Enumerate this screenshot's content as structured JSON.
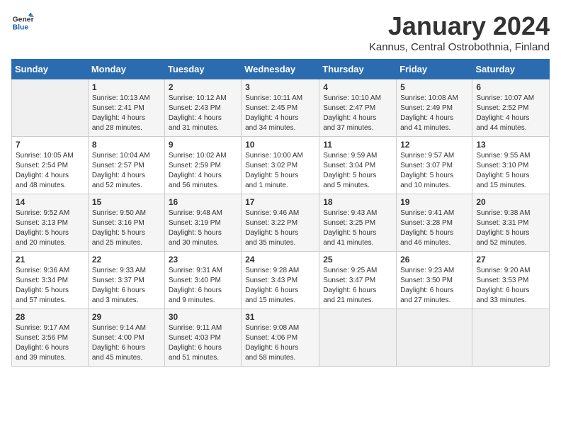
{
  "header": {
    "logo_line1": "General",
    "logo_line2": "Blue",
    "month": "January 2024",
    "location": "Kannus, Central Ostrobothnia, Finland"
  },
  "weekdays": [
    "Sunday",
    "Monday",
    "Tuesday",
    "Wednesday",
    "Thursday",
    "Friday",
    "Saturday"
  ],
  "weeks": [
    [
      {
        "day": "",
        "info": ""
      },
      {
        "day": "1",
        "info": "Sunrise: 10:13 AM\nSunset: 2:41 PM\nDaylight: 4 hours\nand 28 minutes."
      },
      {
        "day": "2",
        "info": "Sunrise: 10:12 AM\nSunset: 2:43 PM\nDaylight: 4 hours\nand 31 minutes."
      },
      {
        "day": "3",
        "info": "Sunrise: 10:11 AM\nSunset: 2:45 PM\nDaylight: 4 hours\nand 34 minutes."
      },
      {
        "day": "4",
        "info": "Sunrise: 10:10 AM\nSunset: 2:47 PM\nDaylight: 4 hours\nand 37 minutes."
      },
      {
        "day": "5",
        "info": "Sunrise: 10:08 AM\nSunset: 2:49 PM\nDaylight: 4 hours\nand 41 minutes."
      },
      {
        "day": "6",
        "info": "Sunrise: 10:07 AM\nSunset: 2:52 PM\nDaylight: 4 hours\nand 44 minutes."
      }
    ],
    [
      {
        "day": "7",
        "info": "Sunrise: 10:05 AM\nSunset: 2:54 PM\nDaylight: 4 hours\nand 48 minutes."
      },
      {
        "day": "8",
        "info": "Sunrise: 10:04 AM\nSunset: 2:57 PM\nDaylight: 4 hours\nand 52 minutes."
      },
      {
        "day": "9",
        "info": "Sunrise: 10:02 AM\nSunset: 2:59 PM\nDaylight: 4 hours\nand 56 minutes."
      },
      {
        "day": "10",
        "info": "Sunrise: 10:00 AM\nSunset: 3:02 PM\nDaylight: 5 hours\nand 1 minute."
      },
      {
        "day": "11",
        "info": "Sunrise: 9:59 AM\nSunset: 3:04 PM\nDaylight: 5 hours\nand 5 minutes."
      },
      {
        "day": "12",
        "info": "Sunrise: 9:57 AM\nSunset: 3:07 PM\nDaylight: 5 hours\nand 10 minutes."
      },
      {
        "day": "13",
        "info": "Sunrise: 9:55 AM\nSunset: 3:10 PM\nDaylight: 5 hours\nand 15 minutes."
      }
    ],
    [
      {
        "day": "14",
        "info": "Sunrise: 9:52 AM\nSunset: 3:13 PM\nDaylight: 5 hours\nand 20 minutes."
      },
      {
        "day": "15",
        "info": "Sunrise: 9:50 AM\nSunset: 3:16 PM\nDaylight: 5 hours\nand 25 minutes."
      },
      {
        "day": "16",
        "info": "Sunrise: 9:48 AM\nSunset: 3:19 PM\nDaylight: 5 hours\nand 30 minutes."
      },
      {
        "day": "17",
        "info": "Sunrise: 9:46 AM\nSunset: 3:22 PM\nDaylight: 5 hours\nand 35 minutes."
      },
      {
        "day": "18",
        "info": "Sunrise: 9:43 AM\nSunset: 3:25 PM\nDaylight: 5 hours\nand 41 minutes."
      },
      {
        "day": "19",
        "info": "Sunrise: 9:41 AM\nSunset: 3:28 PM\nDaylight: 5 hours\nand 46 minutes."
      },
      {
        "day": "20",
        "info": "Sunrise: 9:38 AM\nSunset: 3:31 PM\nDaylight: 5 hours\nand 52 minutes."
      }
    ],
    [
      {
        "day": "21",
        "info": "Sunrise: 9:36 AM\nSunset: 3:34 PM\nDaylight: 5 hours\nand 57 minutes."
      },
      {
        "day": "22",
        "info": "Sunrise: 9:33 AM\nSunset: 3:37 PM\nDaylight: 6 hours\nand 3 minutes."
      },
      {
        "day": "23",
        "info": "Sunrise: 9:31 AM\nSunset: 3:40 PM\nDaylight: 6 hours\nand 9 minutes."
      },
      {
        "day": "24",
        "info": "Sunrise: 9:28 AM\nSunset: 3:43 PM\nDaylight: 6 hours\nand 15 minutes."
      },
      {
        "day": "25",
        "info": "Sunrise: 9:25 AM\nSunset: 3:47 PM\nDaylight: 6 hours\nand 21 minutes."
      },
      {
        "day": "26",
        "info": "Sunrise: 9:23 AM\nSunset: 3:50 PM\nDaylight: 6 hours\nand 27 minutes."
      },
      {
        "day": "27",
        "info": "Sunrise: 9:20 AM\nSunset: 3:53 PM\nDaylight: 6 hours\nand 33 minutes."
      }
    ],
    [
      {
        "day": "28",
        "info": "Sunrise: 9:17 AM\nSunset: 3:56 PM\nDaylight: 6 hours\nand 39 minutes."
      },
      {
        "day": "29",
        "info": "Sunrise: 9:14 AM\nSunset: 4:00 PM\nDaylight: 6 hours\nand 45 minutes."
      },
      {
        "day": "30",
        "info": "Sunrise: 9:11 AM\nSunset: 4:03 PM\nDaylight: 6 hours\nand 51 minutes."
      },
      {
        "day": "31",
        "info": "Sunrise: 9:08 AM\nSunset: 4:06 PM\nDaylight: 6 hours\nand 58 minutes."
      },
      {
        "day": "",
        "info": ""
      },
      {
        "day": "",
        "info": ""
      },
      {
        "day": "",
        "info": ""
      }
    ]
  ]
}
